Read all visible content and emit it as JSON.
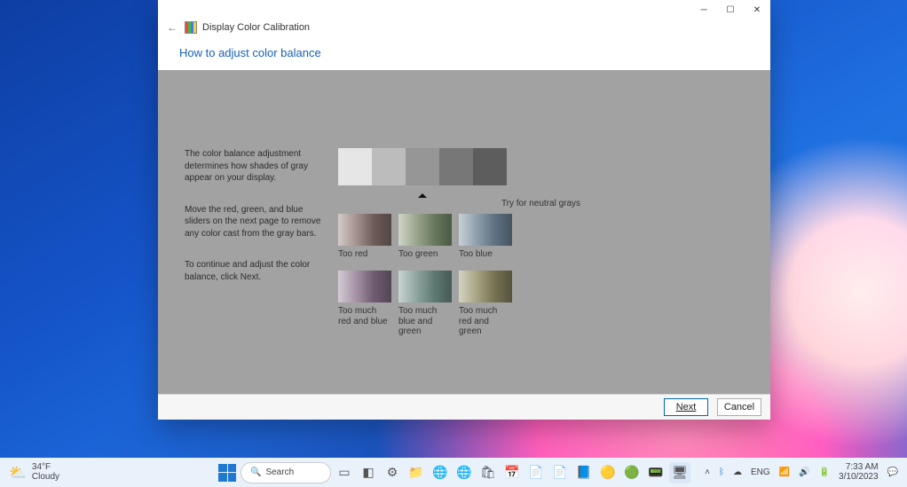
{
  "window": {
    "app_title": "Display Color Calibration",
    "heading": "How to adjust color balance",
    "paragraph1": "The color balance adjustment determines how shades of gray appear on your display.",
    "paragraph2": "Move the red, green, and blue sliders on the next page to remove any color cast from the gray bars.",
    "paragraph3": "To continue and adjust the color balance, click Next.",
    "try_neutral": "Try for neutral grays",
    "strip": [
      "#e6e6e6",
      "#bcbcbc",
      "#969696",
      "#777777",
      "#5d5d5d"
    ],
    "swatches": [
      {
        "label": "Too red"
      },
      {
        "label": "Too green"
      },
      {
        "label": "Too blue"
      },
      {
        "label": "Too much red and blue"
      },
      {
        "label": "Too much blue and green"
      },
      {
        "label": "Too much red and green"
      }
    ],
    "next_btn": "Next",
    "cancel_btn": "Cancel"
  },
  "taskbar": {
    "temp": "34°F",
    "cond": "Cloudy",
    "search_placeholder": "Search",
    "lang": "ENG",
    "time": "7:33 AM",
    "date": "3/10/2023"
  }
}
